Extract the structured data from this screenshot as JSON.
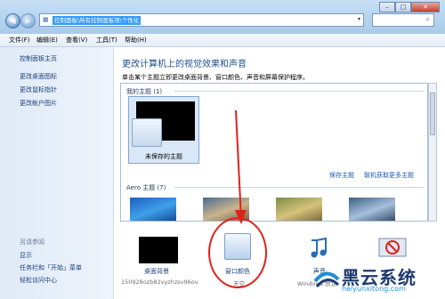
{
  "address_bar": {
    "path": "控制面板\\所有控制面板项\\个性化"
  },
  "menu": [
    "文件(F)",
    "编辑(E)",
    "查看(V)",
    "工具(T)",
    "帮助(H)"
  ],
  "sidebar": {
    "items": [
      {
        "label": "控制面板主页"
      },
      {
        "label": "更改桌面图标"
      },
      {
        "label": "更改鼠标指针"
      },
      {
        "label": "更改帐户图片"
      }
    ],
    "see_also_title": "另请参阅",
    "see_also": [
      {
        "label": "显示"
      },
      {
        "label": "任务栏和「开始」菜单"
      },
      {
        "label": "轻松访问中心"
      }
    ]
  },
  "main": {
    "title": "更改计算机上的视觉效果和声音",
    "description": "单击某个主题立即更改桌面背景、窗口颜色、声音和屏幕保护程序。"
  },
  "themes": {
    "my_themes_header": "我的主题 (1)",
    "unsaved_theme_label": "未保存的主题",
    "save_theme_link": "保存主题",
    "get_more_link": "联机获取更多主题",
    "aero_header": "Aero 主题 (7)"
  },
  "bottom": {
    "desktop_bg_label": "桌面背景",
    "desktop_bg_sub": "150928ozb82vyzhzsv96ov",
    "window_color_label": "窗口颜色",
    "window_color_sub": "天空",
    "sound_label": "声音",
    "sound_sub": "Windows 默认",
    "screensaver_label": "屏幕保护程序"
  },
  "watermark": {
    "text": "黑云系统",
    "url": "heiyunxitong.com"
  },
  "colors": {
    "accent": "#1e4e8c",
    "highlight": "#e0211a",
    "link": "#1a55b5"
  }
}
